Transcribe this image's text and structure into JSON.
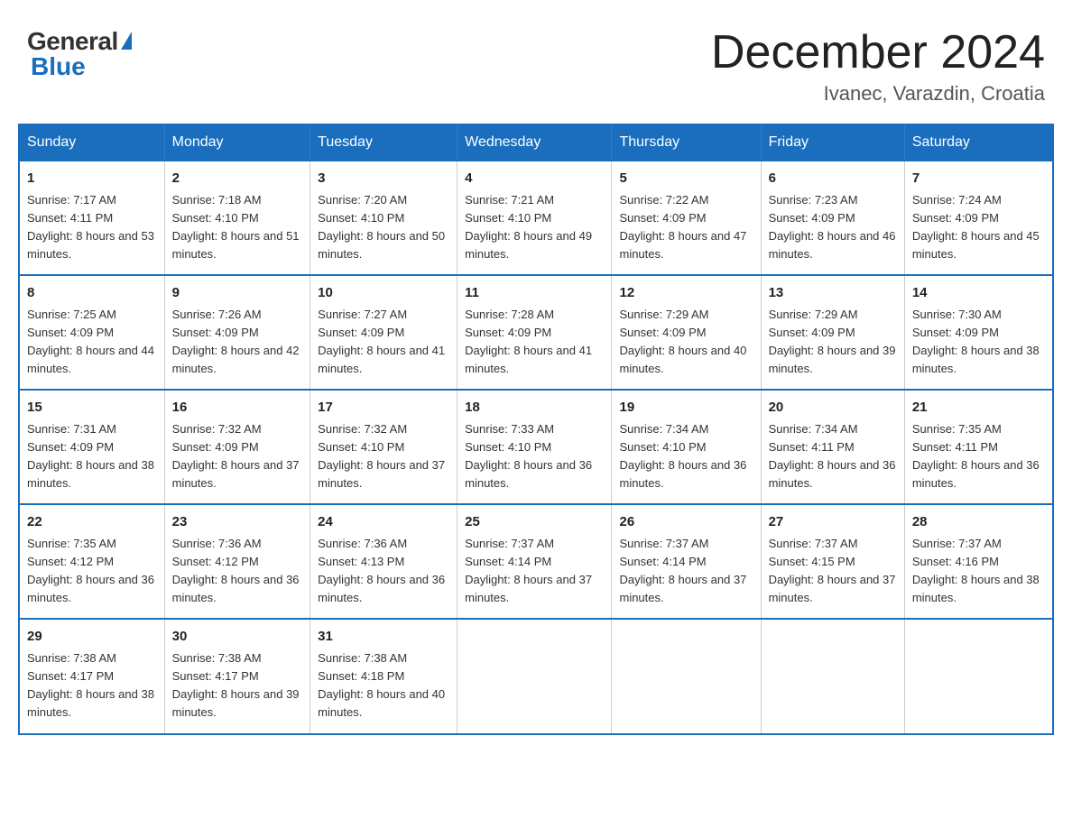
{
  "header": {
    "logo_general": "General",
    "logo_blue": "Blue",
    "title": "December 2024",
    "location": "Ivanec, Varazdin, Croatia"
  },
  "days_of_week": [
    "Sunday",
    "Monday",
    "Tuesday",
    "Wednesday",
    "Thursday",
    "Friday",
    "Saturday"
  ],
  "weeks": [
    [
      {
        "day": "1",
        "sunrise": "7:17 AM",
        "sunset": "4:11 PM",
        "daylight": "8 hours and 53 minutes."
      },
      {
        "day": "2",
        "sunrise": "7:18 AM",
        "sunset": "4:10 PM",
        "daylight": "8 hours and 51 minutes."
      },
      {
        "day": "3",
        "sunrise": "7:20 AM",
        "sunset": "4:10 PM",
        "daylight": "8 hours and 50 minutes."
      },
      {
        "day": "4",
        "sunrise": "7:21 AM",
        "sunset": "4:10 PM",
        "daylight": "8 hours and 49 minutes."
      },
      {
        "day": "5",
        "sunrise": "7:22 AM",
        "sunset": "4:09 PM",
        "daylight": "8 hours and 47 minutes."
      },
      {
        "day": "6",
        "sunrise": "7:23 AM",
        "sunset": "4:09 PM",
        "daylight": "8 hours and 46 minutes."
      },
      {
        "day": "7",
        "sunrise": "7:24 AM",
        "sunset": "4:09 PM",
        "daylight": "8 hours and 45 minutes."
      }
    ],
    [
      {
        "day": "8",
        "sunrise": "7:25 AM",
        "sunset": "4:09 PM",
        "daylight": "8 hours and 44 minutes."
      },
      {
        "day": "9",
        "sunrise": "7:26 AM",
        "sunset": "4:09 PM",
        "daylight": "8 hours and 42 minutes."
      },
      {
        "day": "10",
        "sunrise": "7:27 AM",
        "sunset": "4:09 PM",
        "daylight": "8 hours and 41 minutes."
      },
      {
        "day": "11",
        "sunrise": "7:28 AM",
        "sunset": "4:09 PM",
        "daylight": "8 hours and 41 minutes."
      },
      {
        "day": "12",
        "sunrise": "7:29 AM",
        "sunset": "4:09 PM",
        "daylight": "8 hours and 40 minutes."
      },
      {
        "day": "13",
        "sunrise": "7:29 AM",
        "sunset": "4:09 PM",
        "daylight": "8 hours and 39 minutes."
      },
      {
        "day": "14",
        "sunrise": "7:30 AM",
        "sunset": "4:09 PM",
        "daylight": "8 hours and 38 minutes."
      }
    ],
    [
      {
        "day": "15",
        "sunrise": "7:31 AM",
        "sunset": "4:09 PM",
        "daylight": "8 hours and 38 minutes."
      },
      {
        "day": "16",
        "sunrise": "7:32 AM",
        "sunset": "4:09 PM",
        "daylight": "8 hours and 37 minutes."
      },
      {
        "day": "17",
        "sunrise": "7:32 AM",
        "sunset": "4:10 PM",
        "daylight": "8 hours and 37 minutes."
      },
      {
        "day": "18",
        "sunrise": "7:33 AM",
        "sunset": "4:10 PM",
        "daylight": "8 hours and 36 minutes."
      },
      {
        "day": "19",
        "sunrise": "7:34 AM",
        "sunset": "4:10 PM",
        "daylight": "8 hours and 36 minutes."
      },
      {
        "day": "20",
        "sunrise": "7:34 AM",
        "sunset": "4:11 PM",
        "daylight": "8 hours and 36 minutes."
      },
      {
        "day": "21",
        "sunrise": "7:35 AM",
        "sunset": "4:11 PM",
        "daylight": "8 hours and 36 minutes."
      }
    ],
    [
      {
        "day": "22",
        "sunrise": "7:35 AM",
        "sunset": "4:12 PM",
        "daylight": "8 hours and 36 minutes."
      },
      {
        "day": "23",
        "sunrise": "7:36 AM",
        "sunset": "4:12 PM",
        "daylight": "8 hours and 36 minutes."
      },
      {
        "day": "24",
        "sunrise": "7:36 AM",
        "sunset": "4:13 PM",
        "daylight": "8 hours and 36 minutes."
      },
      {
        "day": "25",
        "sunrise": "7:37 AM",
        "sunset": "4:14 PM",
        "daylight": "8 hours and 37 minutes."
      },
      {
        "day": "26",
        "sunrise": "7:37 AM",
        "sunset": "4:14 PM",
        "daylight": "8 hours and 37 minutes."
      },
      {
        "day": "27",
        "sunrise": "7:37 AM",
        "sunset": "4:15 PM",
        "daylight": "8 hours and 37 minutes."
      },
      {
        "day": "28",
        "sunrise": "7:37 AM",
        "sunset": "4:16 PM",
        "daylight": "8 hours and 38 minutes."
      }
    ],
    [
      {
        "day": "29",
        "sunrise": "7:38 AM",
        "sunset": "4:17 PM",
        "daylight": "8 hours and 38 minutes."
      },
      {
        "day": "30",
        "sunrise": "7:38 AM",
        "sunset": "4:17 PM",
        "daylight": "8 hours and 39 minutes."
      },
      {
        "day": "31",
        "sunrise": "7:38 AM",
        "sunset": "4:18 PM",
        "daylight": "8 hours and 40 minutes."
      },
      null,
      null,
      null,
      null
    ]
  ],
  "labels": {
    "sunrise_prefix": "Sunrise: ",
    "sunset_prefix": "Sunset: ",
    "daylight_prefix": "Daylight: "
  }
}
